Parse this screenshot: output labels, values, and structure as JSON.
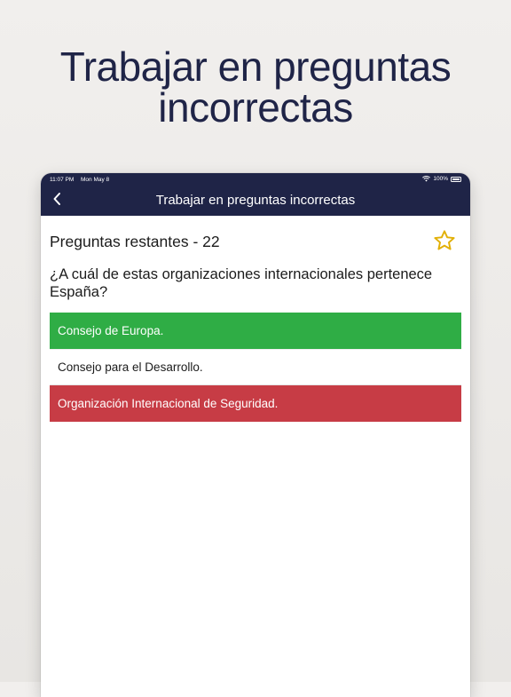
{
  "promo": {
    "headline_line1": "Trabajar en preguntas",
    "headline_line2": "incorrectas"
  },
  "status_bar": {
    "time": "11:07 PM",
    "date": "Mon May 8",
    "battery": "100%"
  },
  "header": {
    "title": "Trabajar en preguntas incorrectas",
    "back_icon": "chevron-left-icon"
  },
  "quiz": {
    "remaining_label": "Preguntas restantes - 22",
    "star_icon": "star-outline-icon",
    "question": "¿A cuál de estas organizaciones internacionales pertenece España?",
    "answers": [
      {
        "text": "Consejo de Europa.",
        "state": "correct"
      },
      {
        "text": "Consejo para el Desarrollo.",
        "state": "neutral"
      },
      {
        "text": "Organización Internacional de Seguridad.",
        "state": "wrong"
      }
    ]
  },
  "colors": {
    "header_bg": "#1f2447",
    "correct": "#2fad45",
    "wrong": "#c73c45",
    "star": "#e2b007"
  }
}
